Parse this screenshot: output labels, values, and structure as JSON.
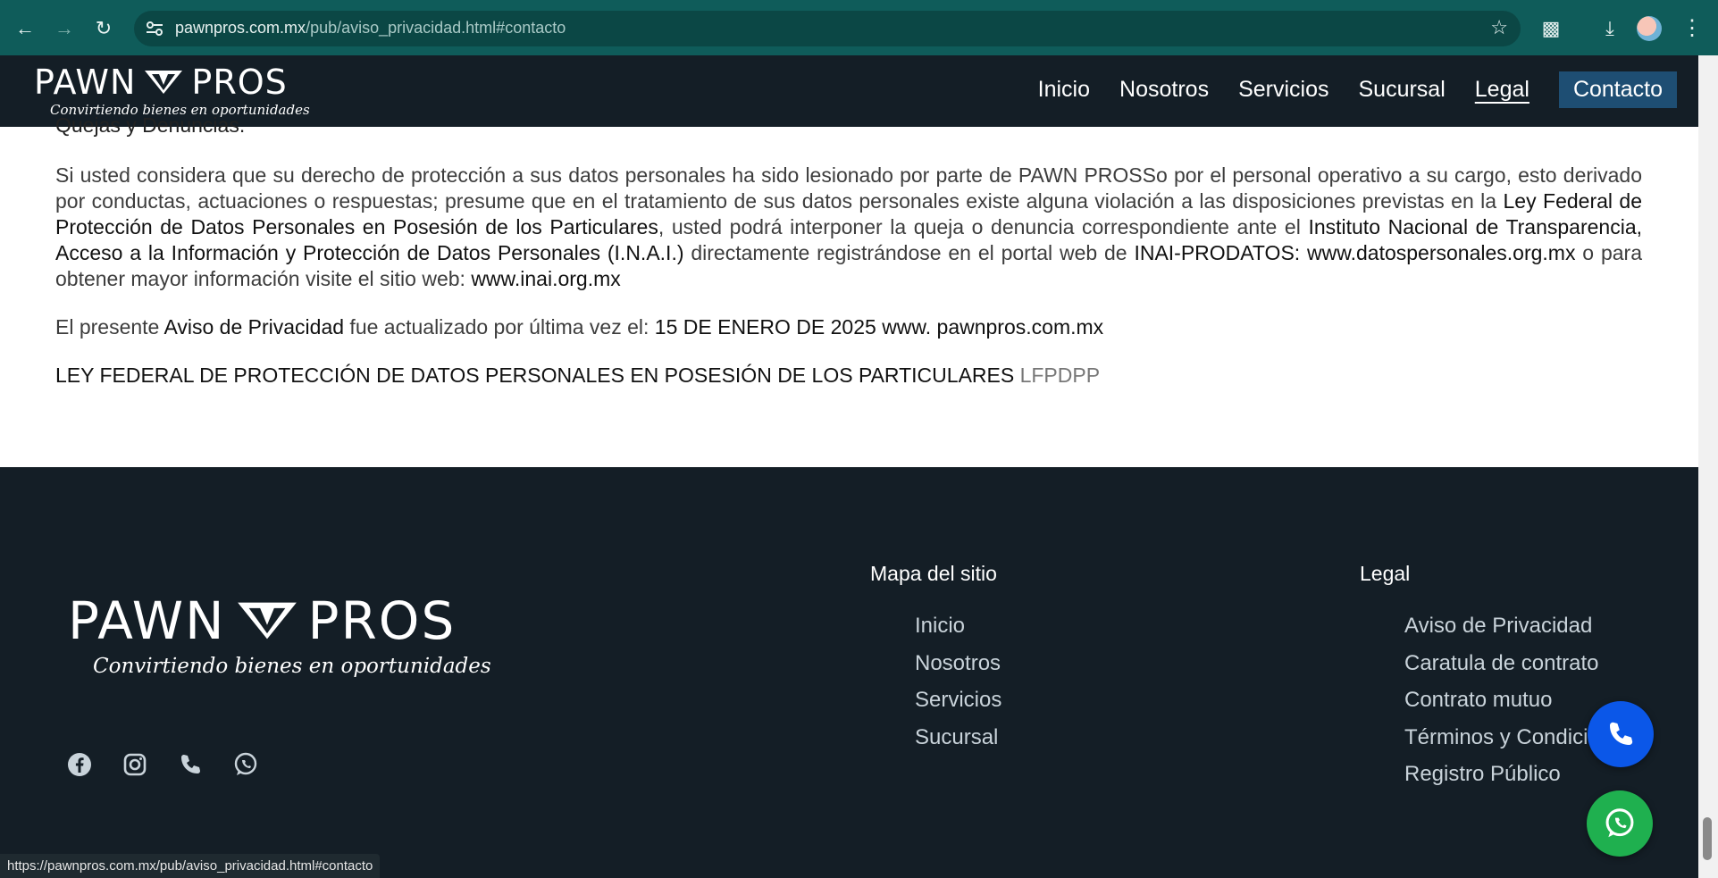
{
  "browser": {
    "url_host": "pawnpros.com.mx",
    "url_path": "/pub/aviso_privacidad.html#contacto",
    "status_url": "https://pawnpros.com.mx/pub/aviso_privacidad.html#contacto"
  },
  "header": {
    "logo_word_left": "PAWN",
    "logo_word_right": "PROS",
    "logo_tagline": "Convirtiendo bienes en oportunidades",
    "nav": [
      {
        "label": "Inicio"
      },
      {
        "label": "Nosotros"
      },
      {
        "label": "Servicios"
      },
      {
        "label": "Sucursal"
      },
      {
        "label": "Legal"
      },
      {
        "label": "Contacto"
      }
    ]
  },
  "content": {
    "cut_heading": "Quejas y Denuncias.",
    "p1": {
      "a": "Si usted considera que su derecho de protección a sus datos personales ha sido lesionado por parte de PAWN PROSSo por el personal operativo a su cargo, esto derivado por conductas, actuaciones o respuestas; presume que en el tratamiento de sus datos personales existe alguna violación a las disposiciones previstas en la ",
      "b": "Ley Federal de Protección de Datos Personales en Posesión de los Particulares",
      "c": ", usted podrá interponer la queja o denuncia correspondiente ante el ",
      "d": "Instituto Nacional de Transparencia, Acceso a la Información y Protección de Datos Personales (I.N.A.I.)",
      "e": " directamente registrándose en el portal web de ",
      "f": "INAI-PRODATOS: www.datospersonales.org.mx",
      "g": " o para obtener mayor información visite el sitio web: ",
      "h": "www.inai.org.mx"
    },
    "p2": {
      "a": "El presente ",
      "b": "Aviso de Privacidad",
      "c": " fue actualizado por última vez el: ",
      "d": "15 DE ENERO DE 2025 www. pawnpros.com.mx"
    },
    "p3": {
      "a": "LEY FEDERAL DE PROTECCIÓN DE DATOS PERSONALES EN POSESIÓN DE LOS PARTICULARES",
      "b": " LFPDPP"
    }
  },
  "footer": {
    "map_title": "Mapa del sitio",
    "map_links": [
      "Inicio",
      "Nosotros",
      "Servicios",
      "Sucursal"
    ],
    "legal_title": "Legal",
    "legal_links": [
      "Aviso de Privacidad",
      "Caratula de contrato",
      "Contrato mutuo",
      "Términos y Condiciones",
      "Registro Público"
    ],
    "socials": [
      "facebook-icon",
      "instagram-icon",
      "phone-icon",
      "whatsapp-icon"
    ]
  },
  "colors": {
    "chrome": "#0f5c5a",
    "dark": "#141e26",
    "contact_button": "#1e4e73",
    "phone_fab": "#0b57e8",
    "whatsapp_fab": "#1fb04f"
  }
}
